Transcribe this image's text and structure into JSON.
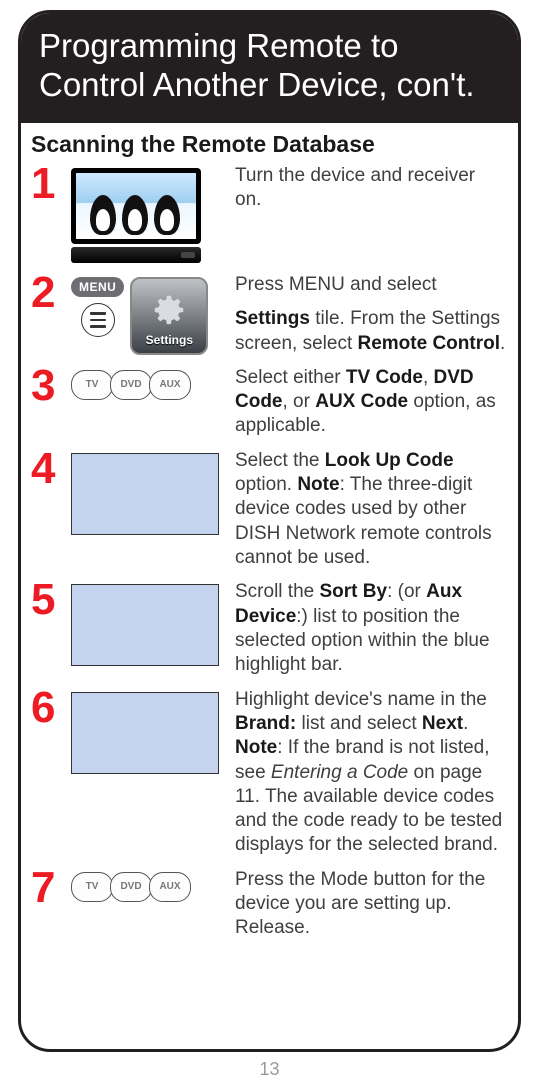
{
  "header_title": "Programming Remote to Control Another Device, con't.",
  "subheading": "Scanning the Remote Database",
  "page_number": "13",
  "settings_tile_label": "Settings",
  "menu_pill": "MENU",
  "mode_labels": {
    "tv": "TV",
    "dvd": "DVD",
    "aux": "AUX"
  },
  "steps": {
    "s1": {
      "num": "1",
      "text": "Turn the device and receiver on."
    },
    "s2": {
      "num": "2",
      "line1": "Press MENU and select",
      "line2_pre": "Settings",
      "line2_mid": " tile. From the Settings screen, select ",
      "line2_post": "Remote Control",
      "line2_end": "."
    },
    "s3": {
      "num": "3",
      "a": "Select either ",
      "b1": "TV Code",
      "c1": ", ",
      "b2": "DVD Code",
      "c2": ", or ",
      "b3": "AUX Code",
      "d": " option, as applicable."
    },
    "s4": {
      "num": "4",
      "a": "Select the ",
      "b": "Look Up Code",
      "c": " option. ",
      "d": "Note",
      "e": ": The three-digit device codes used by other DISH Network remote controls cannot be used."
    },
    "s5": {
      "num": "5",
      "a": "Scroll the ",
      "b": "Sort By",
      "c": ": (or ",
      "d": "Aux Device",
      "e": ":) list to position the selected option within the blue highlight bar."
    },
    "s6": {
      "num": "6",
      "a": "Highlight device's name in the ",
      "b": "Brand:",
      "c": " list and select ",
      "d": "Next",
      "e": ". ",
      "f": "Note",
      "g": ": If the brand is not listed, see ",
      "h": "Entering a Code",
      "i": " on page 11. The available device codes and the code ready to be tested displays for the selected brand."
    },
    "s7": {
      "num": "7",
      "text": "Press the Mode button for the device you are setting up. Release."
    }
  }
}
